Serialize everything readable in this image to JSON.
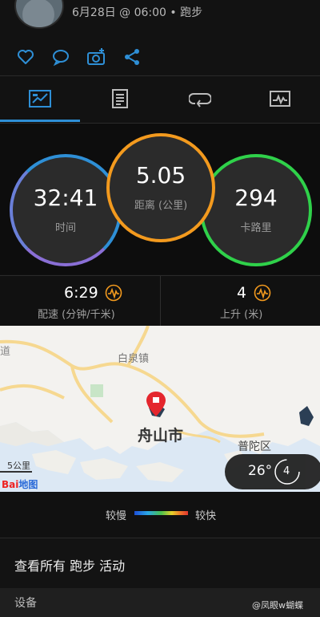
{
  "header": {
    "date_text": "6月28日 @ 06:00 • 跑步"
  },
  "actions": [
    {
      "icon": "heart-icon"
    },
    {
      "icon": "comment-icon"
    },
    {
      "icon": "camera-add-icon"
    },
    {
      "icon": "share-icon"
    }
  ],
  "tabs": [
    {
      "icon": "overview-icon",
      "active": true
    },
    {
      "icon": "details-icon"
    },
    {
      "icon": "laps-icon"
    },
    {
      "icon": "chart-icon"
    }
  ],
  "stats": {
    "time": {
      "value": "32:41",
      "label": "时间"
    },
    "distance": {
      "value": "5.05",
      "label": "距离 (公里)"
    },
    "calories": {
      "value": "294",
      "label": "卡路里"
    }
  },
  "metrics": {
    "pace": {
      "value": "6:29",
      "label": "配速 (分钟/千米)"
    },
    "ascent": {
      "value": "4",
      "label": "上升 (米)"
    }
  },
  "map": {
    "labels": {
      "left_road": "道",
      "baiquan": "白泉镇",
      "city": "舟山市",
      "putuo": "普陀区",
      "scale": "5公里",
      "logo_bai": "Bai",
      "logo_du": "地图"
    },
    "weather": {
      "temp": "26°",
      "wind": "4"
    }
  },
  "legend": {
    "slow": "较慢",
    "fast": "较快"
  },
  "view_all": "查看所有 跑步 活动",
  "device_label": "设备",
  "watermark": "@凤眼w蝴蝶",
  "colors": {
    "blue": "#2e8fd6",
    "orange": "#f39a1e",
    "green": "#2fd14a",
    "purple": "#8a6fd6"
  }
}
